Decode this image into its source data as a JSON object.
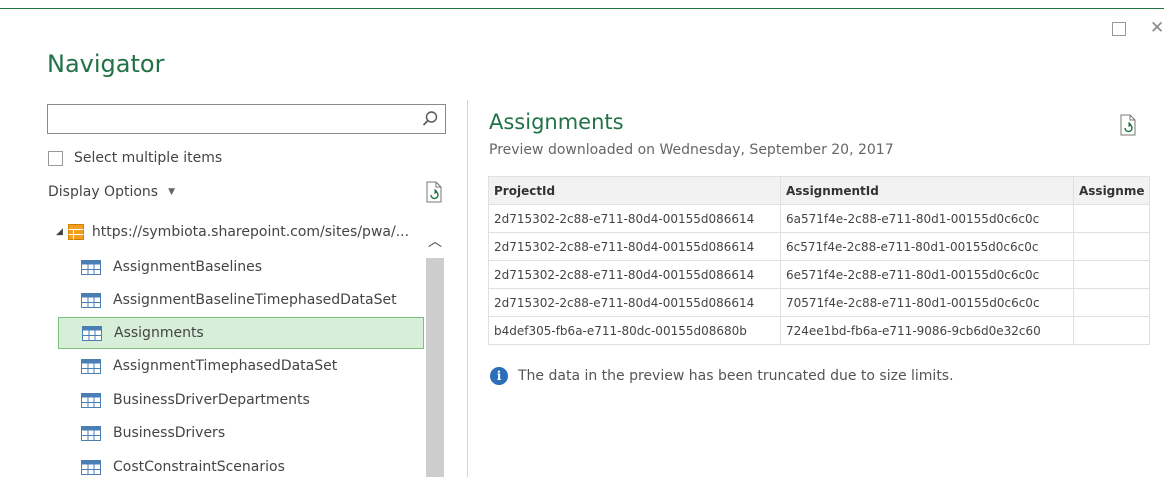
{
  "window": {
    "title": "Navigator",
    "maximize_glyph": "☐",
    "close_glyph": "✕"
  },
  "left_pane": {
    "search": {
      "value": "",
      "placeholder": "",
      "icon": "search-icon"
    },
    "select_multiple_label": "Select multiple items",
    "display_options_label": "Display Options",
    "tree": {
      "root_label": "https://symbiota.sharepoint.com/sites/pwa/...",
      "items": [
        {
          "label": "AssignmentBaselines",
          "selected": false
        },
        {
          "label": "AssignmentBaselineTimephasedDataSet",
          "selected": false
        },
        {
          "label": "Assignments",
          "selected": true
        },
        {
          "label": "AssignmentTimephasedDataSet",
          "selected": false
        },
        {
          "label": "BusinessDriverDepartments",
          "selected": false
        },
        {
          "label": "BusinessDrivers",
          "selected": false
        },
        {
          "label": "CostConstraintScenarios",
          "selected": false
        }
      ]
    }
  },
  "preview": {
    "title": "Assignments",
    "subtitle": "Preview downloaded on Wednesday, September 20, 2017",
    "table": {
      "columns": [
        "ProjectId",
        "AssignmentId",
        "Assignme"
      ],
      "rows": [
        [
          "2d715302-2c88-e711-80d4-00155d086614",
          "6a571f4e-2c88-e711-80d1-00155d0c6c0c",
          ""
        ],
        [
          "2d715302-2c88-e711-80d4-00155d086614",
          "6c571f4e-2c88-e711-80d1-00155d0c6c0c",
          ""
        ],
        [
          "2d715302-2c88-e711-80d4-00155d086614",
          "6e571f4e-2c88-e711-80d1-00155d0c6c0c",
          ""
        ],
        [
          "2d715302-2c88-e711-80d4-00155d086614",
          "70571f4e-2c88-e711-80d1-00155d0c6c0c",
          ""
        ],
        [
          "b4def305-fb6a-e711-80dc-00155d08680b",
          "724ee1bd-fb6a-e711-9086-9cb6d0e32c60",
          ""
        ]
      ]
    },
    "truncation_note": "The data in the preview has been truncated due to size limits."
  },
  "colors": {
    "accent": "#217346",
    "selected_bg": "#d7efd9",
    "selected_border": "#7cc07f",
    "info": "#2b6fb6",
    "table_icon": "#4a7fb5",
    "db_icon": "#f0a01e"
  }
}
